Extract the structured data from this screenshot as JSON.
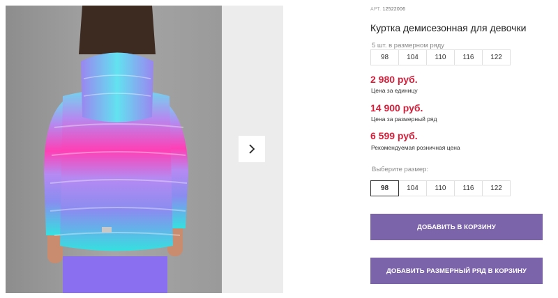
{
  "product": {
    "sku_prefix": "АРТ.",
    "sku": "12522006",
    "title": "Куртка демисезонная для девочки"
  },
  "size_row": {
    "label": "5 шт. в размерном ряду",
    "sizes": [
      "98",
      "104",
      "110",
      "116",
      "122"
    ]
  },
  "prices": [
    {
      "value": "2 980 руб.",
      "note": "Цена за единицу"
    },
    {
      "value": "14 900 руб.",
      "note": "Цена за размерный ряд"
    },
    {
      "value": "6 599 руб.",
      "note": "Рекомендуемая розничная цена"
    }
  ],
  "size_picker": {
    "label": "Выберите размер:",
    "sizes": [
      "98",
      "104",
      "110",
      "116",
      "122"
    ],
    "selected": "98"
  },
  "buttons": {
    "add_to_cart": "ДОБАВИТЬ В КОРЗИНУ",
    "add_size_row": "ДОБАВИТЬ РАЗМЕРНЫЙ РЯД В КОРЗИНУ"
  },
  "colors": {
    "price": "#d6203b",
    "accent_button": "#7c64ab"
  },
  "gallery": {
    "next_icon": "chevron-right-icon"
  }
}
